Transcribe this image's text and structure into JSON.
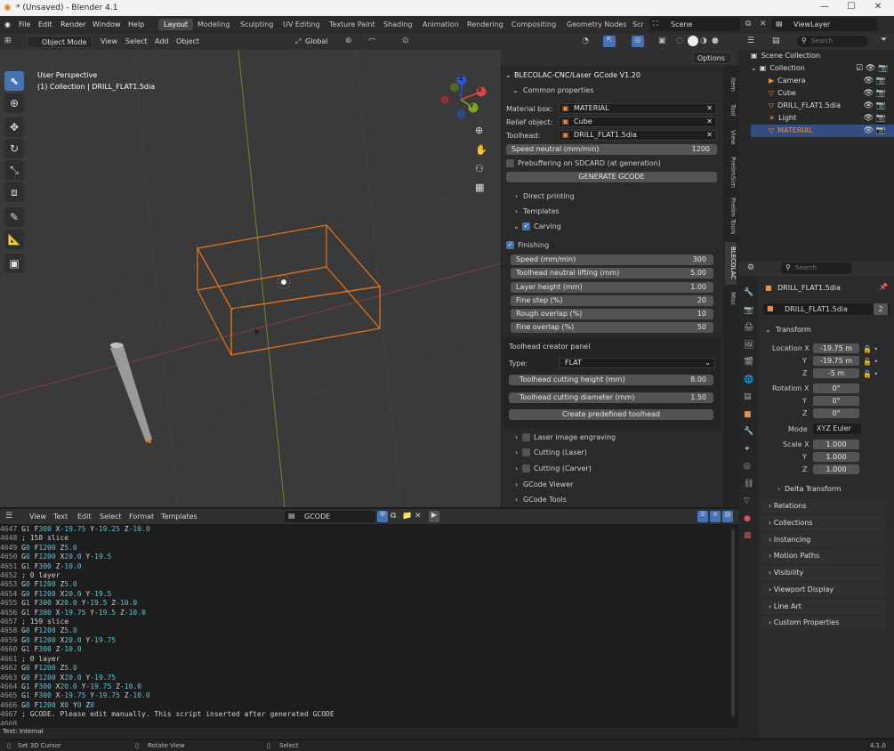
{
  "window": {
    "title": "* (Unsaved) - Blender 4.1",
    "min": "—",
    "max": "☐",
    "close": "✕"
  },
  "menu": [
    "File",
    "Edit",
    "Render",
    "Window",
    "Help"
  ],
  "workspaces": [
    "Layout",
    "Modeling",
    "Sculpting",
    "UV Editing",
    "Texture Paint",
    "Shading",
    "Animation",
    "Rendering",
    "Compositing",
    "Geometry Nodes",
    "Scr"
  ],
  "scene": "Scene",
  "viewlayer": "ViewLayer",
  "header3d": {
    "mode": "Object Mode",
    "view": "View",
    "select": "Select",
    "add": "Add",
    "object": "Object",
    "orientation": "Global",
    "options": "Options"
  },
  "viewport": {
    "perspective": "User Perspective",
    "collection": "(1) Collection | DRILL_FLAT1.5dia",
    "axis_x": "X",
    "axis_y": "Y",
    "axis_z": "Z"
  },
  "npanel": {
    "title": "BLECOLAC-CNC/Laser GCode V1.20",
    "common": "Common properties",
    "material_box_label": "Material box:",
    "material_box": "MATERIAL",
    "relief_label": "Relief object:",
    "relief": "Cube",
    "toolhead_label": "Toolhead:",
    "toolhead": "DRILL_FLAT1.5dia",
    "speed_neutral_label": "Speed neutral (mm/min)",
    "speed_neutral": "1200",
    "prebuffering": "Prebuffering on SDCARD (at generation)",
    "generate": "GENERATE GCODE",
    "direct_printing": "Direct printing",
    "templates": "Templates",
    "carving": "Carving",
    "finishing": "Finishing",
    "finishing_fields": [
      {
        "label": "Speed (mm/min)",
        "value": "300"
      },
      {
        "label": "Toolhead neutral lifting (mm)",
        "value": "5.00"
      },
      {
        "label": "Layer height (mm)",
        "value": "1.00"
      },
      {
        "label": "Fine step (%)",
        "value": "20"
      },
      {
        "label": "Rough overlap (%)",
        "value": "10"
      },
      {
        "label": "Fine overlap (%)",
        "value": "50"
      }
    ],
    "creator_title": "Toolhead creator panel",
    "type_label": "Type:",
    "type": "FLAT",
    "cut_height_label": "Toolhead cutting height (mm)",
    "cut_height": "8.00",
    "cut_diam_label": "Toolhead cutting diameter (mm)",
    "cut_diam": "1.50",
    "create_btn": "Create predefined toolhead",
    "laser": "Laser image engraving",
    "cut_laser": "Cutting (Laser)",
    "cut_carver": "Cutting (Carver)",
    "gcode_viewer": "GCode Viewer",
    "gcode_tools": "GCode Tools"
  },
  "vtabs": [
    "Item",
    "Tool",
    "View",
    "PrelimSim",
    "Prelim Tools",
    "BLECOLAC",
    "Misc"
  ],
  "outliner": {
    "search": "Search",
    "scene_collection": "Scene Collection",
    "items": [
      {
        "name": "Collection",
        "icon": "collection-icon",
        "color": "#dddddd"
      },
      {
        "name": "Camera",
        "icon": "camera-icon",
        "color": "#dddddd"
      },
      {
        "name": "Cube",
        "icon": "mesh-icon",
        "color": "#dddddd"
      },
      {
        "name": "DRILL_FLAT1.5dia",
        "icon": "mesh-icon",
        "color": "#dddddd"
      },
      {
        "name": "Light",
        "icon": "light-icon",
        "color": "#dddddd"
      },
      {
        "name": "MATERIAL",
        "icon": "mesh-icon",
        "color": "#e8914a"
      }
    ]
  },
  "properties": {
    "search": "Search",
    "object_name": "DRILL_FLAT1.5dia",
    "datablock": "DRILL_FLAT1.5dia",
    "users": "2",
    "transform": "Transform",
    "location_label": "Location X",
    "loc_x": "-19.75 m",
    "loc_y": "-19.75 m",
    "loc_z": "-5 m",
    "rotation_label": "Rotation X",
    "rot_x": "0°",
    "rot_y": "0°",
    "rot_z": "0°",
    "mode_label": "Mode",
    "mode": "XYZ Euler",
    "scale_label": "Scale X",
    "scale_x": "1.000",
    "scale_y": "1.000",
    "scale_z": "1.000",
    "y": "Y",
    "z": "Z",
    "delta": "Delta Transform",
    "sections": [
      "Relations",
      "Collections",
      "Instancing",
      "Motion Paths",
      "Visibility",
      "Viewport Display",
      "Line Art",
      "Custom Properties"
    ]
  },
  "texteditor": {
    "menu": [
      "View",
      "Text",
      "Edit",
      "Select",
      "Format",
      "Templates"
    ],
    "filename": "GCODE",
    "lines": [
      {
        "n": "4647",
        "t": "G1 F300 X-19.75 Y-19.25 Z-10.0"
      },
      {
        "n": "4648",
        "t": "; 158 slice"
      },
      {
        "n": "4649",
        "t": "G0 F1200 Z5.0"
      },
      {
        "n": "4650",
        "t": "G0 F1200 X20.0 Y-19.5"
      },
      {
        "n": "4651",
        "t": "G1 F300 Z-10.0"
      },
      {
        "n": "4652",
        "t": "; 0 layer"
      },
      {
        "n": "4653",
        "t": "G0 F1200 Z5.0"
      },
      {
        "n": "4654",
        "t": "G0 F1200 X20.0 Y-19.5"
      },
      {
        "n": "4655",
        "t": "G1 F300 X20.0 Y-19.5 Z-10.0"
      },
      {
        "n": "4656",
        "t": "G1 F300 X-19.75 Y-19.5 Z-10.0"
      },
      {
        "n": "4657",
        "t": "; 159 slice"
      },
      {
        "n": "4658",
        "t": "G0 F1200 Z5.0"
      },
      {
        "n": "4659",
        "t": "G0 F1200 X20.0 Y-19.75"
      },
      {
        "n": "4660",
        "t": "G1 F300 Z-10.0"
      },
      {
        "n": "4661",
        "t": "; 0 layer"
      },
      {
        "n": "4662",
        "t": "G0 F1200 Z5.0"
      },
      {
        "n": "4663",
        "t": "G0 F1200 X20.0 Y-19.75"
      },
      {
        "n": "4664",
        "t": "G1 F300 X20.0 Y-19.75 Z-10.0"
      },
      {
        "n": "4665",
        "t": "G1 F300 X-19.75 Y-19.75 Z-10.0"
      },
      {
        "n": "4666",
        "t": "G0 F1200 X0 Y0 Z0"
      },
      {
        "n": "4667",
        "t": "; GCODE. Please edit manually. This script inserted after generated GCODE"
      },
      {
        "n": "4668",
        "t": ""
      }
    ],
    "footer": "Text: Internal"
  },
  "status": {
    "left": "Set 3D Cursor",
    "mid": "Rotate View",
    "right": "Select",
    "version": "4.1.0"
  },
  "colors": {
    "accent": "#4772b3",
    "orange": "#e8914a",
    "bg": "#3a3a3a"
  }
}
